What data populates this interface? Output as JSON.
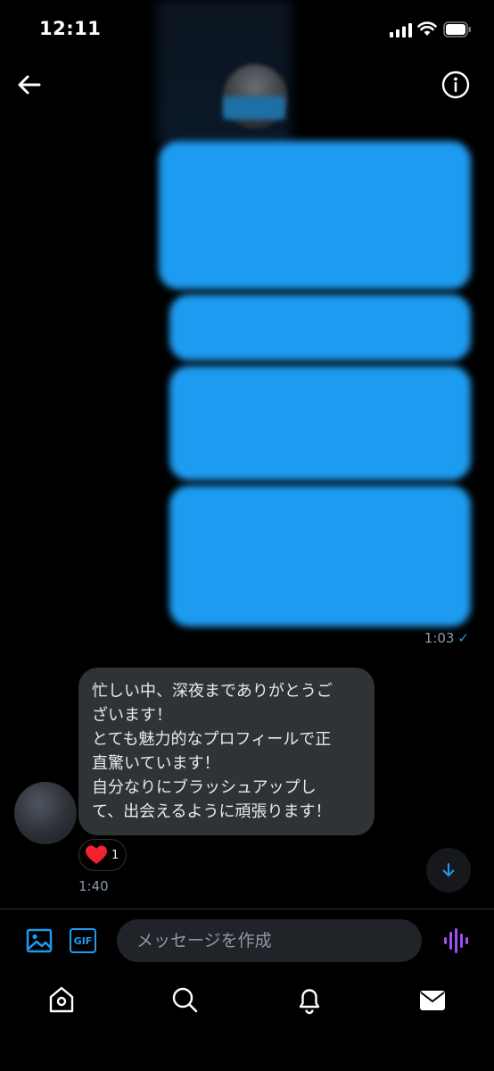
{
  "status_bar": {
    "time": "12:11"
  },
  "header": {
    "back_icon": "arrow-left-icon",
    "info_icon": "info-circle-icon"
  },
  "sent_messages": {
    "time": "1:03",
    "read_icon": "check-icon"
  },
  "received_message": {
    "lines": [
      "忙しい中、深夜までありがとうご",
      "ざいます！",
      "とても魅力的なプロフィールで正",
      "直驚いています！",
      "自分なりにブラッシュアップし",
      "て、出会えるように頑張ります！"
    ],
    "reaction_count": "1",
    "time": "1:40"
  },
  "composer": {
    "gif_label": "GIF",
    "placeholder": "メッセージを作成"
  },
  "colors": {
    "accent": "#1d9bf0",
    "received_bubble": "#2f3336",
    "voice": "#7856ff",
    "heart": "#f91880"
  }
}
